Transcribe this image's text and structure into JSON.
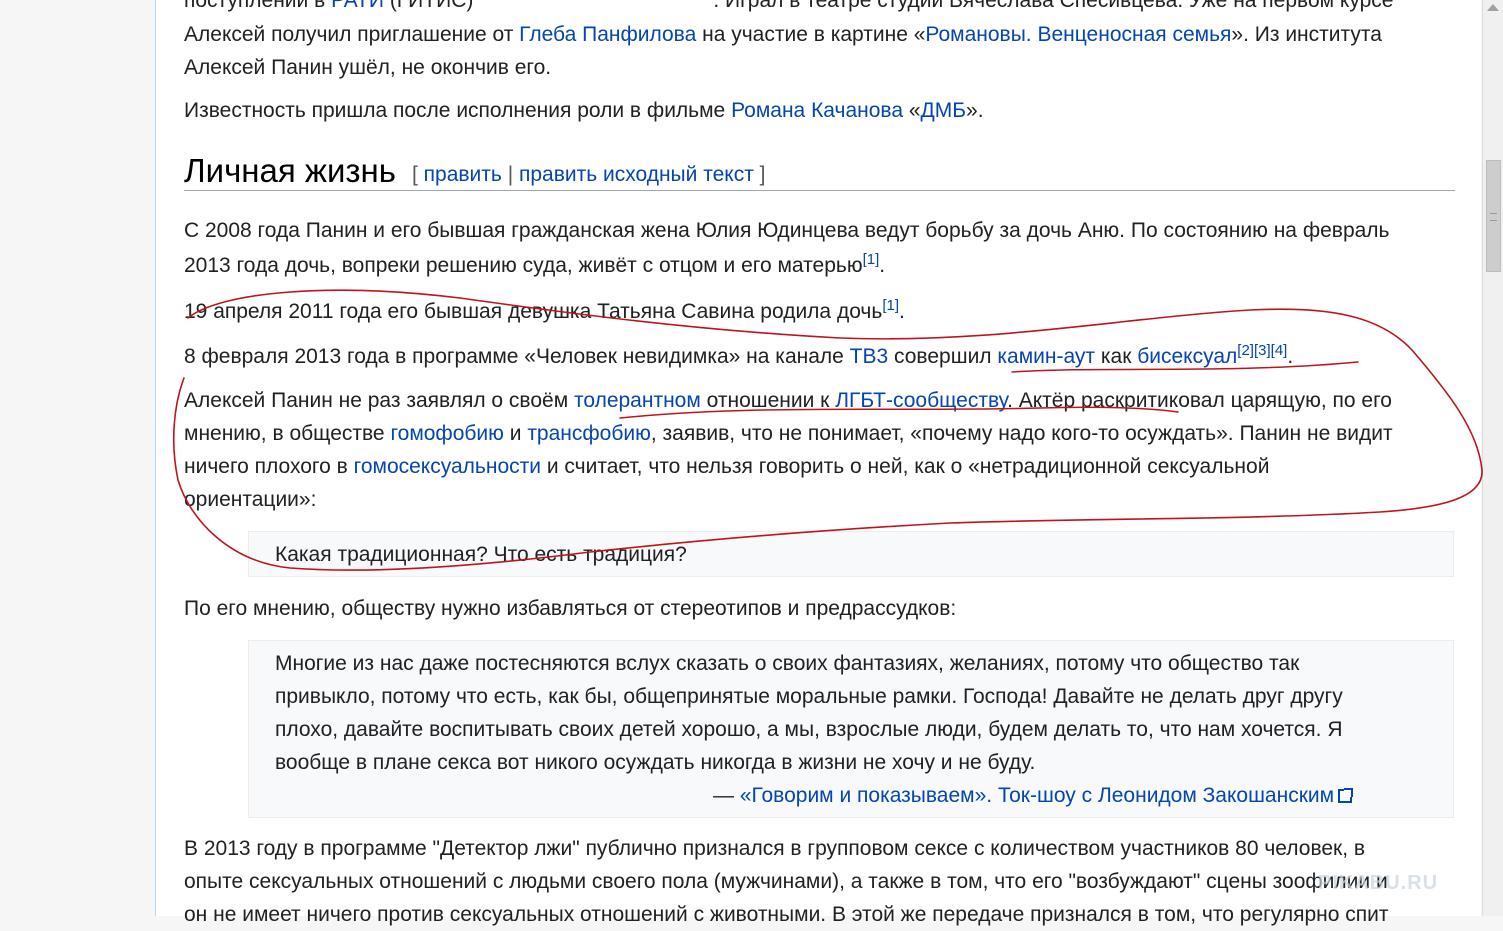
{
  "article": {
    "p0": {
      "line1_start": "поступлении в ",
      "link_rati": "РАТИ",
      "line1_mid": " (ГИТИС)",
      "line1_end": ". Играл в театре студии Вячеслава Спесивцева. Уже на первом курсе",
      "line2_start": "Алексей получил приглашение от ",
      "link_panfilov": "Глеба Панфилова",
      "line2_mid": " на участие в картине «",
      "link_romanovy": "Романовы. Венценосная семья",
      "line2_end": "». Из института",
      "line3": "Алексей Панин ушёл, не окончив его."
    },
    "p1": {
      "start": "Известность пришла после исполнения роли в фильме ",
      "link_kachanov": "Романа Качанова",
      "mid": " «",
      "link_dmb": "ДМБ",
      "end": "»."
    },
    "section": {
      "title": "Личная жизнь",
      "open": "[ ",
      "edit": "править",
      "sep": " | ",
      "edit_source": "править исходный текст",
      "close": " ]"
    },
    "p2": {
      "line1": "С 2008 года Панин и его бывшая гражданская жена Юлия Юдинцева ведут борьбу за дочь Аню. По состоянию на февраль",
      "line2": "2013 года дочь, вопреки решению суда, живёт с отцом и его матерью",
      "ref": "[1]",
      "end": "."
    },
    "p3": {
      "text": "19 апреля 2011 года его бывшая девушка Татьяна Савина родила дочь",
      "ref": "[1]",
      "end": "."
    },
    "p4": {
      "start": "8 февраля 2013 года в программе «Человек невидимка» на канале ",
      "link_tv3": "ТВ3",
      "mid1": " совершил ",
      "link_comingout": "камин-аут",
      "mid2": " как ",
      "link_bisexual": "бисексуал",
      "ref2": "[2]",
      "ref3": "[3]",
      "ref4": "[4]",
      "end": "."
    },
    "p5": {
      "l1_start": "Алексей Панин не раз заявлял о своём ",
      "link_tolerant": "толерантном",
      "l1_mid": " отношении к ",
      "link_lgbt": "ЛГБТ-сообществу",
      "l1_end": ". Актёр раскритиковал царящую, по его",
      "l2_start": "мнению, в обществе ",
      "link_homophobia": "гомофобию",
      "l2_mid": " и ",
      "link_transphobia": "трансфобию",
      "l2_end": ", заявив, что не понимает, «почему надо кого-то осуждать». Панин не видит",
      "l3_start": "ничего плохого в ",
      "link_homosexuality": "гомосексуальности",
      "l3_end": " и считает, что нельзя говорить о ней, как о «нетрадиционной сексуальной",
      "l4": "ориентации»:"
    },
    "quote1": "Какая традиционная? Что есть традиция?",
    "p6": "По его мнению, обществу нужно избавляться от стереотипов и предрассудков:",
    "quote2": {
      "line1": "Многие из нас даже постесняются вслух сказать о своих фантазиях, желаниях, потому что общество так",
      "line2": "привыкло, потому что есть, как бы, общепринятые моральные рамки. Господа! Давайте не делать друг другу",
      "line3": "плохо, давайте воспитывать своих детей хорошо, а мы, взрослые люди, будем делать то, что нам хочется. Я",
      "line4": "вообще в плане секса вот никого осуждать никогда в жизни не хочу и не буду.",
      "dash": "— ",
      "source_link": "«Говорим и показываем». Ток-шоу с Леонидом Закошанским",
      "source_icon": "external-link-icon"
    },
    "p7": {
      "line1": "В 2013 году в программе \"Детектор лжи\" публично признался в групповом сексе с количеством участников 80 человек, в",
      "line2": "опыте сексуальных отношений с людьми своего пола (мужчинами), а также в том, что его \"возбуждают\" сцены зоофилии и",
      "line3": "он не имеет ничего против сексуальных отношений с животными. В этой же передаче признался в том, что регулярно спит"
    }
  },
  "annotation": {
    "color": "#c0141c"
  },
  "watermark": "PIKABU.RU",
  "scrollbar": {
    "up_icon": "chevron-up-icon"
  }
}
